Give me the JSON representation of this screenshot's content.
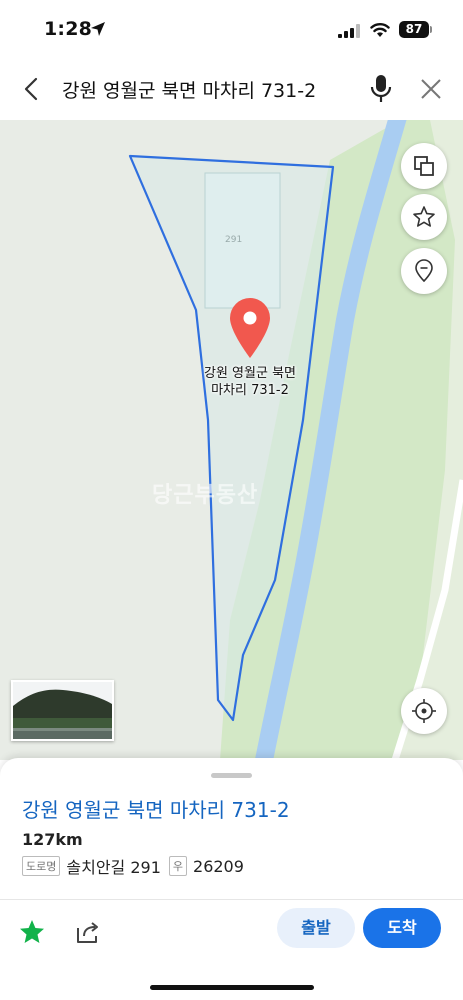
{
  "status": {
    "time": "1:28",
    "battery": "87"
  },
  "search": {
    "query": "강원 영월군 북면 마차리 731-2"
  },
  "map": {
    "parcel_number": "291",
    "pin_label_line1": "강원 영월군 북면",
    "pin_label_line2": "마차리 731-2",
    "watermark": "당근부동산",
    "buttons": [
      "layers-icon",
      "star-outline-icon",
      "location-pin-outline-icon",
      "my-location-icon"
    ],
    "colors": {
      "parcel_outline": "#2f6fdf",
      "river": "#a9cdf2",
      "pin": "#f1584e",
      "green_area": "#d3e8c6"
    }
  },
  "place": {
    "title": "강원 영월군 북면 마차리 731-2",
    "distance": "127km",
    "road_tag": "도로명",
    "road_address": "솔치안길 291",
    "postal_tag": "우",
    "postal_code": "26209"
  },
  "actions": {
    "depart": "출발",
    "arrive": "도착"
  }
}
